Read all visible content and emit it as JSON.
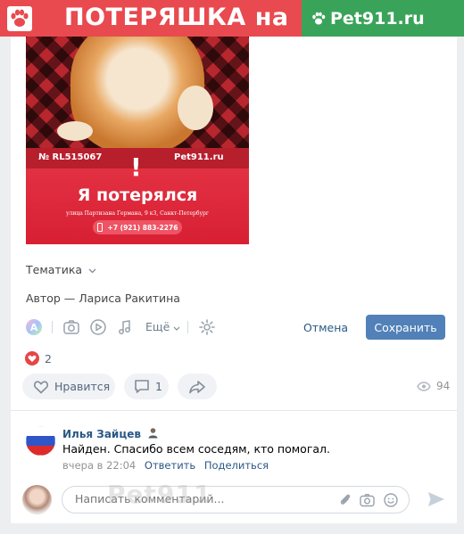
{
  "banner": {
    "title": "ПОТЕРЯШКА на",
    "site": "Pet911.ru",
    "colors": {
      "red": "#e84a4f",
      "green": "#3aa35a"
    }
  },
  "poster": {
    "number": "№ RL515067",
    "site": "Pet911.ru",
    "headline": "Я потерялся",
    "address": "улица Партизана Германа, 9 к3, Санкт-Петербург",
    "phone": "+7 (921) 883-2276"
  },
  "post": {
    "topic_label": "Тематика",
    "author_label": "Автор — Лариса Ракитина",
    "toolbar": {
      "more_label": "Ещё"
    },
    "cancel_label": "Отмена",
    "save_label": "Сохранить",
    "likes_count": "2",
    "like_label": "Нравится",
    "comments_count": "1",
    "views_count": "94"
  },
  "comment": {
    "author": "Илья Зайцев",
    "text": "Найден. Спасибо всем соседям, кто помогал.",
    "time": "вчера в 22:04",
    "reply_label": "Ответить",
    "share_label": "Поделиться"
  },
  "composer": {
    "placeholder": "Написать комментарий...",
    "watermark": "Pet911"
  },
  "colors": {
    "link": "#2a5885",
    "save_button": "#5181b8",
    "heart": "#e64646"
  }
}
